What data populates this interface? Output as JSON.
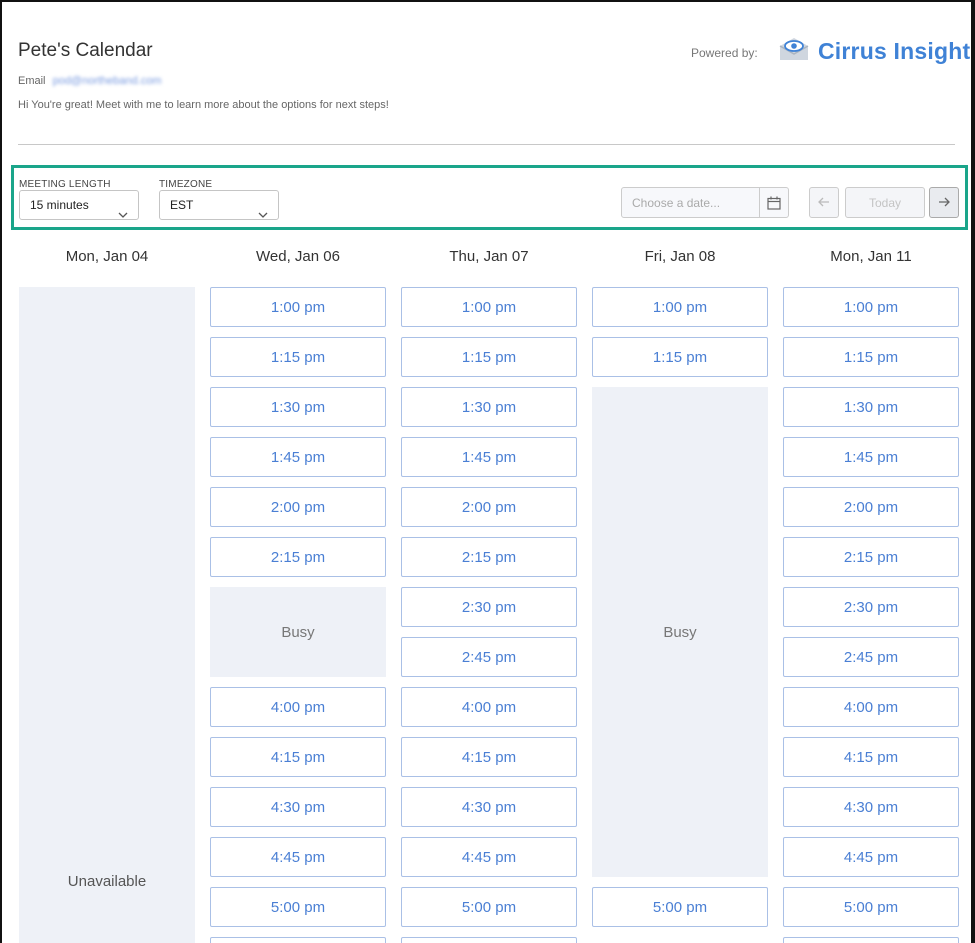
{
  "header": {
    "title": "Pete's Calendar",
    "email_label": "Email",
    "email_value": "pod@northeband.com",
    "intro": "Hi You're great! Meet with me to learn more about the options for next steps!",
    "powered_by": "Powered by:",
    "brand": "Cirrus Insight",
    "brand_color": "#3f82d6"
  },
  "toolbar": {
    "meeting_length_label": "MEETING LENGTH",
    "meeting_length_value": "15 minutes",
    "timezone_label": "TIMEZONE",
    "timezone_value": "EST",
    "date_placeholder": "Choose a date...",
    "today_label": "Today",
    "highlight_color": "#1aa58a"
  },
  "days": [
    {
      "label": "Mon, Jan 04",
      "unavailable": "Unavailable"
    },
    {
      "label": "Wed, Jan 06",
      "slots": [
        "1:00 pm",
        "1:15 pm",
        "1:30 pm",
        "1:45 pm",
        "2:00 pm",
        "2:15 pm",
        "4:00 pm",
        "4:15 pm",
        "4:30 pm",
        "4:45 pm",
        "5:00 pm"
      ],
      "busy": "Busy"
    },
    {
      "label": "Thu, Jan 07",
      "slots": [
        "1:00 pm",
        "1:15 pm",
        "1:30 pm",
        "1:45 pm",
        "2:00 pm",
        "2:15 pm",
        "2:30 pm",
        "2:45 pm",
        "4:00 pm",
        "4:15 pm",
        "4:30 pm",
        "4:45 pm",
        "5:00 pm"
      ]
    },
    {
      "label": "Fri, Jan 08",
      "slots": [
        "1:00 pm",
        "1:15 pm",
        "5:00 pm"
      ],
      "busy": "Busy"
    },
    {
      "label": "Mon, Jan 11",
      "slots": [
        "1:00 pm",
        "1:15 pm",
        "1:30 pm",
        "1:45 pm",
        "2:00 pm",
        "2:15 pm",
        "2:30 pm",
        "2:45 pm",
        "4:00 pm",
        "4:15 pm",
        "4:30 pm",
        "4:45 pm",
        "5:00 pm"
      ]
    }
  ]
}
